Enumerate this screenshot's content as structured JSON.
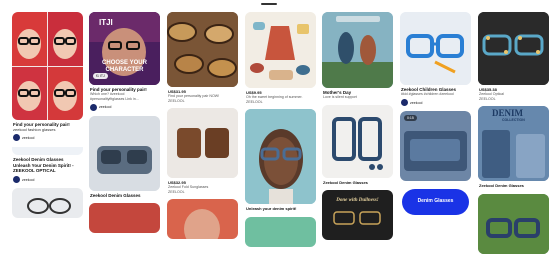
{
  "colors": {
    "accent": "#1a33e6",
    "avatar": "#1b2a6b",
    "text": "#111111",
    "muted": "#555555"
  },
  "pins": {
    "c1p1": {
      "title": "Find your personality pair!",
      "desc": "zeekool fashion glasses",
      "author": "zeekool"
    },
    "c1p2": {
      "title": "Zeekool Denim Glasses",
      "desc": "Unleash Your Denim Spirit! - ZEEKOOL OPTICAL",
      "author": "zeekool"
    },
    "c2p1": {
      "overlay_top": "ITJI",
      "overlay": "CHOOSE YOUR CHARACTER",
      "pill": "f1 ITJ",
      "title": "Find your personality pair!",
      "desc": "Which one? #zeekool #personalityfitglasses Link in...",
      "author": "zeekool"
    },
    "c2p2": {
      "title": "Zeekool Denim Glasses"
    },
    "c3p1": {
      "price": "US$31.95",
      "title": "Find your personality pair NOW!",
      "desc": "ZEELOOL"
    },
    "c3p2": {
      "price": "US$32.95",
      "title": "Zeekool Fold Sunglasses",
      "desc": "ZEELOOL"
    },
    "c4p1": {
      "price": "US$9.95",
      "title": "Oh the sweet beginning of summer.",
      "desc": "ZEELOOL"
    },
    "c4p2": {
      "title": "Unleash your denim spirit!"
    },
    "c5p1": {
      "title": "Mother's Day",
      "desc": "Love is silent support"
    },
    "c5p2": {
      "title": "Zeekool Denim Glasses"
    },
    "c5p3": {
      "overlay": "Done with Dullness!"
    },
    "c6p1": {
      "title": "Zeekool Children Glasses",
      "desc": "#kid #glasses #children #zeekool",
      "author": "zeekool"
    },
    "c6p2": {
      "badge": "0:15",
      "overlay": "Denim Glasses"
    },
    "c7p1": {
      "price": "US$35.38",
      "title": "Zeekool Optical",
      "desc": "ZEELOOL"
    },
    "c7p2": {
      "overlay_top": "DENIM",
      "overlay_sub": "COLLECTION",
      "title": "Zeekool Denim Glasses"
    }
  }
}
